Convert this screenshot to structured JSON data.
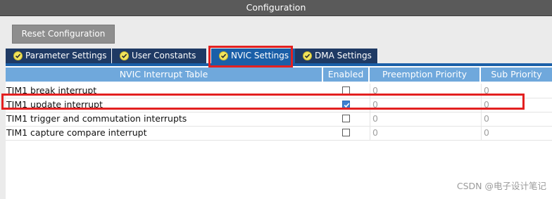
{
  "window": {
    "title": "Configuration"
  },
  "toolbar": {
    "reset_label": "Reset Configuration"
  },
  "tabs": [
    {
      "label": "Parameter Settings",
      "active": false
    },
    {
      "label": "User Constants",
      "active": false
    },
    {
      "label": "NVIC Settings",
      "active": true
    },
    {
      "label": "DMA Settings",
      "active": false
    }
  ],
  "table": {
    "headers": [
      "NVIC Interrupt Table",
      "Enabled",
      "Preemption Priority",
      "Sub Priority"
    ],
    "rows": [
      {
        "name": "TIM1 break interrupt",
        "enabled": false,
        "preemption": "0",
        "sub": "0"
      },
      {
        "name": "TIM1 update interrupt",
        "enabled": true,
        "preemption": "0",
        "sub": "0"
      },
      {
        "name": "TIM1 trigger and commutation interrupts",
        "enabled": false,
        "preemption": "0",
        "sub": "0"
      },
      {
        "name": "TIM1 capture compare interrupt",
        "enabled": false,
        "preemption": "0",
        "sub": "0"
      }
    ]
  },
  "watermark": "CSDN @电子设计笔记",
  "colors": {
    "tab_bg": "#1f3a64",
    "tab_active": "#1a5fa8",
    "header_bg": "#6fa8dc",
    "highlight": "#e32020"
  },
  "icons": {
    "tab_status": "check-circle-icon",
    "checkbox_checked": "checkmark-icon"
  }
}
